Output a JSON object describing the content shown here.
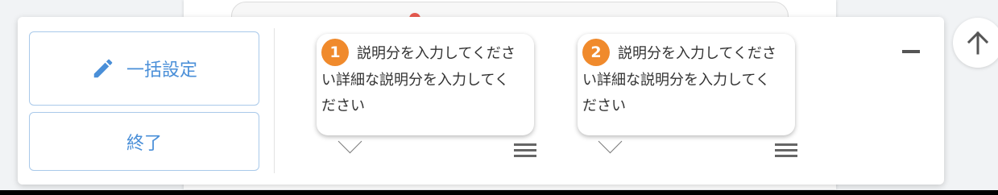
{
  "panel": {
    "bulk_button_label": "一括設定",
    "end_button_label": "終了"
  },
  "steps": [
    {
      "number": "1",
      "text": "説明分を入力してください詳細な説明分を入力してください"
    },
    {
      "number": "2",
      "text": "説明分を入力してください詳細な説明分を入力してください"
    }
  ],
  "icons": {
    "bulk": "pencil-icon",
    "drag": "drag-handle-icon",
    "minimize": "minimize-icon",
    "scroll_top": "arrow-up-icon"
  },
  "colors": {
    "accent": "#4a8fd8",
    "badge": "#f08a2c"
  }
}
